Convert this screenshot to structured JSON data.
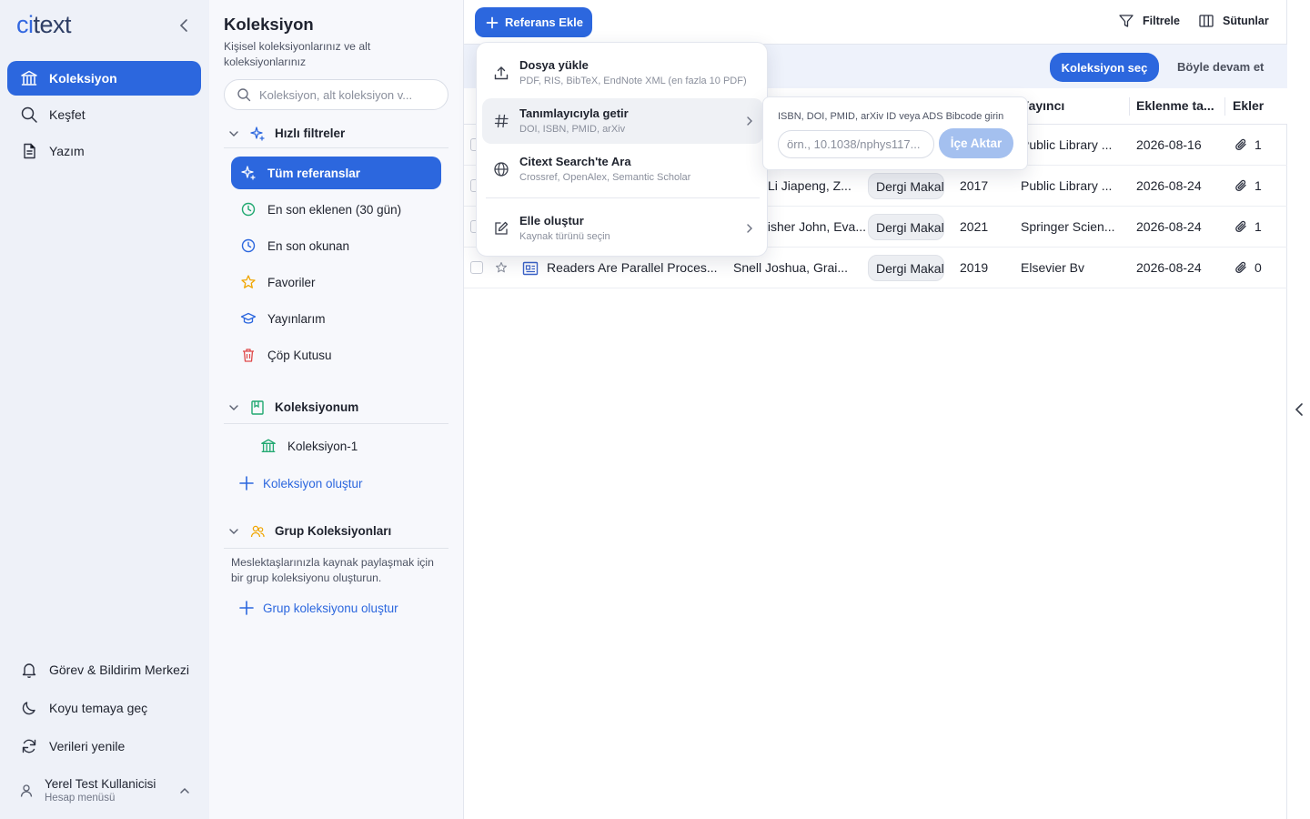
{
  "brand": {
    "logo_prefix": "ci",
    "logo_rest": "text",
    "accent": "#2c67de"
  },
  "nav": {
    "items": [
      {
        "label": "Koleksiyon",
        "icon": "bank-icon",
        "active": true
      },
      {
        "label": "Keşfet",
        "icon": "search-icon"
      },
      {
        "label": "Yazım",
        "icon": "document-icon"
      }
    ],
    "footer": [
      {
        "label": "Görev & Bildirim Merkezi",
        "icon": "bell-icon"
      },
      {
        "label": "Koyu temaya geç",
        "icon": "moon-icon"
      },
      {
        "label": "Verileri yenile",
        "icon": "refresh-icon"
      }
    ],
    "user": {
      "name": "Yerel Test Kullanicisi",
      "sub": "Hesap menüsü"
    }
  },
  "panel": {
    "title": "Koleksiyon",
    "desc": "Kişisel koleksiyonlarınız ve alt koleksiyonlarınız",
    "search_placeholder": "Koleksiyon, alt koleksiyon v...",
    "quick": {
      "title": "Hızlı filtreler",
      "items": [
        {
          "label": "Tüm referanslar",
          "icon": "sparkle-icon",
          "active": true
        },
        {
          "label": "En son eklenen (30 gün)",
          "icon": "clock-icon"
        },
        {
          "label": "En son okunan",
          "icon": "clock-icon"
        },
        {
          "label": "Favoriler",
          "icon": "star-icon"
        },
        {
          "label": "Yayınlarım",
          "icon": "graduation-cap-icon"
        },
        {
          "label": "Çöp Kutusu",
          "icon": "trash-icon"
        }
      ]
    },
    "mycol": {
      "title": "Koleksiyonum",
      "items": [
        {
          "label": "Koleksiyon-1"
        }
      ],
      "add": "Koleksiyon oluştur"
    },
    "group": {
      "title": "Grup Koleksiyonları",
      "desc": "Meslektaşlarınızla kaynak paylaşmak için bir grup koleksiyonu oluşturun.",
      "add": "Grup koleksiyonu oluştur"
    }
  },
  "toolbar": {
    "add_label": "Referans Ekle",
    "filter": "Filtrele",
    "columns": "Sütunlar"
  },
  "banner": {
    "select": "Koleksiyon seç",
    "continue": "Böyle devam et"
  },
  "table": {
    "headers": {
      "publisher": "Yayıncı",
      "added": "Eklenme ta...",
      "attachments": "Ekler"
    },
    "rows": [
      {
        "title": "",
        "authors": "",
        "type": "",
        "year": "",
        "publisher": "Public Library ...",
        "added": "2026-08-16",
        "attachments": "1"
      },
      {
        "title": "",
        "authors": "Li Jiapeng, Z...",
        "type": "Dergi Makal",
        "year": "2017",
        "publisher": "Public Library ...",
        "added": "2026-08-24",
        "attachments": "1"
      },
      {
        "title": "",
        "authors": "Fisher John, Eva...",
        "type": "Dergi Makal",
        "year": "2021",
        "publisher": "Springer Scien...",
        "added": "2026-08-24",
        "attachments": "1"
      },
      {
        "title": "Readers Are Parallel Proces...",
        "authors": "Snell Joshua, Grai...",
        "type": "Dergi Makal",
        "year": "2019",
        "publisher": "Elsevier Bv",
        "added": "2026-08-24",
        "attachments": "0"
      }
    ]
  },
  "add_menu": {
    "items": [
      {
        "title": "Dosya yükle",
        "sub": "PDF, RIS, BibTeX, EndNote XML (en fazla 10 PDF)",
        "icon": "upload-icon"
      },
      {
        "title": "Tanımlayıcıyla getir",
        "sub": "DOI, ISBN, PMID, arXiv",
        "icon": "hash-icon"
      },
      {
        "title": "Citext Search'te Ara",
        "sub": "Crossref, OpenAlex, Semantic Scholar",
        "icon": "globe-icon"
      },
      {
        "title": "Elle oluştur",
        "sub": "Kaynak türünü seçin",
        "icon": "edit-icon"
      }
    ]
  },
  "identifier_popup": {
    "label": "ISBN, DOI, PMID, arXiv ID veya ADS Bibcode girin",
    "placeholder": "örn., 10.1038/nphys117...",
    "button": "İçe Aktar"
  }
}
